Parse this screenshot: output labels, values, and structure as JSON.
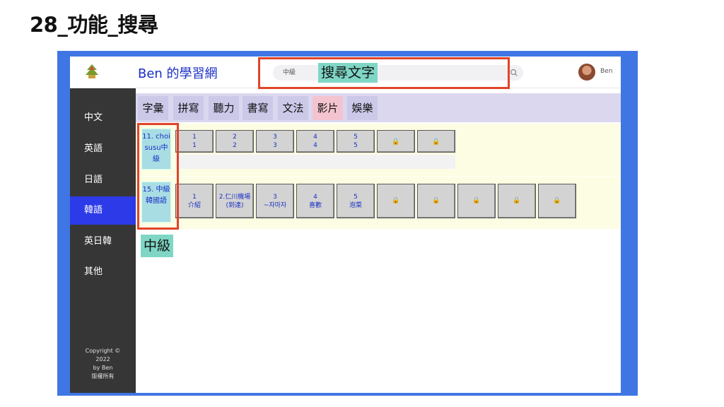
{
  "slide_title": "28_功能_搜尋",
  "header": {
    "app_title": "Ben 的學習網",
    "search_value": "中級",
    "user_name": "Ben"
  },
  "annotations": {
    "search_note": "搜尋文字",
    "level_note": "中級"
  },
  "sidebar": {
    "items": [
      {
        "label": "中文",
        "active": false
      },
      {
        "label": "英語",
        "active": false
      },
      {
        "label": "日語",
        "active": false
      },
      {
        "label": "韓語",
        "active": true
      },
      {
        "label": "英日韓",
        "active": false
      },
      {
        "label": "其他",
        "active": false
      }
    ],
    "copyright": [
      "Copyright ©",
      "2022",
      "by Ben",
      "版權所有"
    ]
  },
  "tabs": [
    {
      "label": "字彙"
    },
    {
      "label": "拼寫"
    },
    {
      "label": "聽力"
    },
    {
      "label": "書寫"
    },
    {
      "label": "文法"
    },
    {
      "label": "影片",
      "highlighted": true
    },
    {
      "label": "娛樂"
    }
  ],
  "rows": [
    {
      "label": "11. choisusu中級",
      "cards": [
        {
          "line1": "1",
          "line2": "1"
        },
        {
          "line1": "2",
          "line2": "2"
        },
        {
          "line1": "3",
          "line2": "3"
        },
        {
          "line1": "4",
          "line2": "4"
        },
        {
          "line1": "5",
          "line2": "5"
        },
        {
          "locked": true
        },
        {
          "locked": true
        }
      ]
    },
    {
      "label": "15. 中級韓國語",
      "cards": [
        {
          "line1": "1",
          "line2": "介紹"
        },
        {
          "line1": "2.仁川機場",
          "line2": "(到達)"
        },
        {
          "line1": "3",
          "line2": "~자마자"
        },
        {
          "line1": "4",
          "line2": "喜歡"
        },
        {
          "line1": "5",
          "line2": "泡菜"
        },
        {
          "locked": true
        },
        {
          "locked": true
        },
        {
          "locked": true
        },
        {
          "locked": true
        },
        {
          "locked": true
        }
      ]
    }
  ],
  "colors": {
    "accent_blue": "#2c3ae8",
    "highlight_red": "#e0442a",
    "note_teal": "#7fd6c5"
  }
}
